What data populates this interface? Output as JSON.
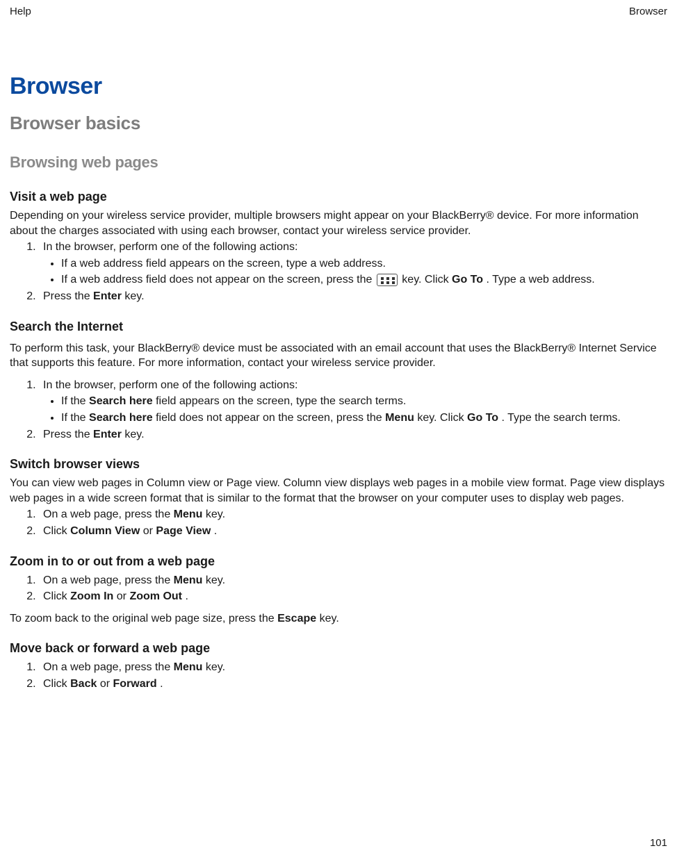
{
  "header": {
    "left": "Help",
    "right": "Browser"
  },
  "title": "Browser",
  "section": "Browser basics",
  "subsection": "Browsing web pages",
  "topics": {
    "visit": {
      "heading": "Visit a web page",
      "intro": "Depending on your wireless service provider, multiple browsers might appear on your BlackBerry® device. For more information about the charges associated with using each browser, contact your wireless service provider.",
      "step1": "In the browser, perform one of the following actions:",
      "bullet1": "If a web address field appears on the screen, type a web address.",
      "bullet2_pre": "If a web address field does not appear on the screen, press the ",
      "bullet2_post_1": " key. Click ",
      "bullet2_goto": "Go To",
      "bullet2_post_2": ". Type a web address.",
      "step2_pre": "Press the ",
      "step2_key": "Enter",
      "step2_post": " key."
    },
    "search": {
      "heading": "Search the Internet",
      "intro": "To perform this task, your BlackBerry® device must be associated with an email account that uses the BlackBerry® Internet Service that supports this feature. For more information, contact your wireless service provider.",
      "step1": "In the browser, perform one of the following actions:",
      "b1_pre": "If the ",
      "b1_bold": "Search here",
      "b1_post": " field appears on the screen, type the search terms.",
      "b2_pre": "If the ",
      "b2_bold1": "Search here",
      "b2_mid1": " field does not appear on the screen, press the ",
      "b2_bold2": "Menu",
      "b2_mid2": " key. Click ",
      "b2_bold3": "Go To",
      "b2_post": ". Type the search terms.",
      "step2_pre": "Press the ",
      "step2_key": "Enter",
      "step2_post": " key."
    },
    "switch": {
      "heading": "Switch browser views",
      "intro": "You can view web pages in Column view or Page view. Column view displays web pages in a mobile view format. Page view displays web pages in a wide screen format that is similar to the format that the browser on your computer uses to display web pages.",
      "s1_pre": "On a web page, press the ",
      "s1_bold": "Menu",
      "s1_post": " key.",
      "s2_pre": "Click ",
      "s2_bold1": "Column View",
      "s2_mid": " or ",
      "s2_bold2": "Page View",
      "s2_post": "."
    },
    "zoom": {
      "heading": "Zoom in to or out from a web page",
      "s1_pre": "On a web page, press the ",
      "s1_bold": "Menu",
      "s1_post": " key.",
      "s2_pre": "Click ",
      "s2_bold1": "Zoom In",
      "s2_mid": " or ",
      "s2_bold2": "Zoom Out",
      "s2_post": ".",
      "after_pre": "To zoom back to the original web page size, press the ",
      "after_bold": "Escape",
      "after_post": " key."
    },
    "move": {
      "heading": "Move back or forward a web page",
      "s1_pre": "On a web page, press the ",
      "s1_bold": "Menu",
      "s1_post": " key.",
      "s2_pre": "Click ",
      "s2_bold1": "Back",
      "s2_mid": " or ",
      "s2_bold2": "Forward",
      "s2_post": "."
    }
  },
  "page_number": "101"
}
